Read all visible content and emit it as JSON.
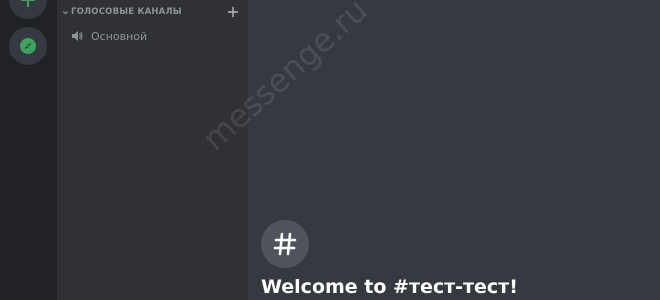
{
  "server_rail": {
    "add_server_icon": "plus-icon",
    "explore_icon": "compass-icon",
    "accent": "#3ba55c"
  },
  "sidebar": {
    "category_label": "ГОЛОСОВЫЕ КАНАЛЫ",
    "channels": [
      {
        "label": "Основной",
        "icon": "speaker-icon"
      }
    ]
  },
  "chat": {
    "welcome_icon": "hash-icon",
    "welcome_title": "Welcome to #тест-тест!"
  },
  "watermark": "messenge.ru"
}
